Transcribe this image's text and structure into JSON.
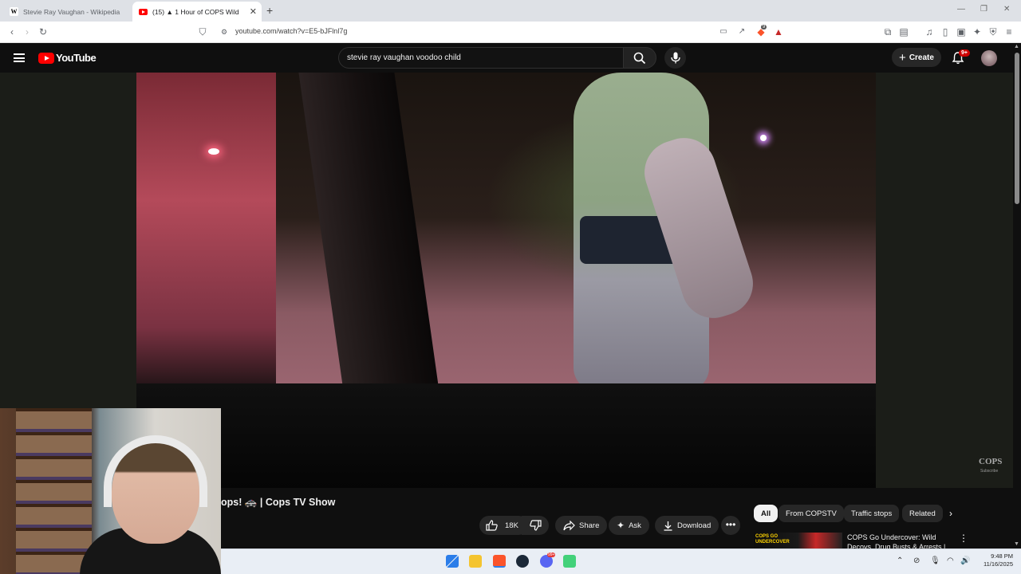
{
  "browser": {
    "tabs": [
      {
        "label": "Stevie Ray Vaughan - Wikipedia",
        "active": false
      },
      {
        "label": "(15)  ▲ 1 Hour of COPS Wild",
        "active": true
      }
    ],
    "url": "youtube.com/watch?v=E5-bJFlnl7g",
    "extension_badge": "9"
  },
  "youtube": {
    "logo_text": "YouTube",
    "search_query": "stevie ray vaughan voodoo child",
    "create_label": "Create",
    "notification_badge": "9+"
  },
  "video": {
    "watermark": "COPS",
    "watermark_sub": "Subscribe",
    "title_visible": "ops! 🚓 | Cops TV Show"
  },
  "actions": {
    "like_count": "18K",
    "share_label": "Share",
    "ask_label": "Ask",
    "download_label": "Download"
  },
  "filters": [
    "All",
    "From COPSTV",
    "Traffic stops",
    "Related"
  ],
  "recommended": {
    "thumb_text": "COPS GO UNDERCOVER",
    "title": "COPS Go Undercover: Wild Decoys, Drug Busts & Arrests |"
  },
  "taskbar": {
    "time": "9:48 PM",
    "date": "11/16/2025",
    "discord_badge": "99+"
  },
  "colors": {
    "youtube_red": "#ff0000",
    "chip_active_bg": "#f1f1f1",
    "page_bg": "#0f0f0f"
  }
}
